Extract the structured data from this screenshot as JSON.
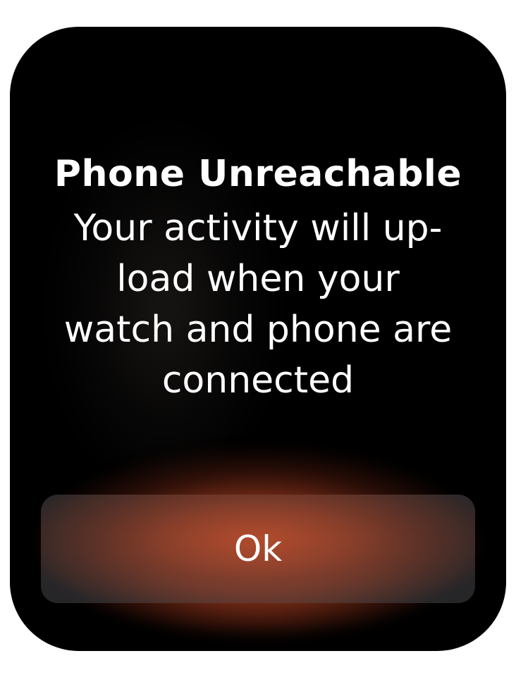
{
  "alert": {
    "title": "Phone Unreachable",
    "message_lines": [
      "Your activity will up-",
      "load when your",
      "watch and phone are",
      "connected"
    ],
    "ok_label": "Ok"
  },
  "colors": {
    "screen_background": "#000000",
    "accent_glow": "#d6542c",
    "text": "#ffffff"
  }
}
